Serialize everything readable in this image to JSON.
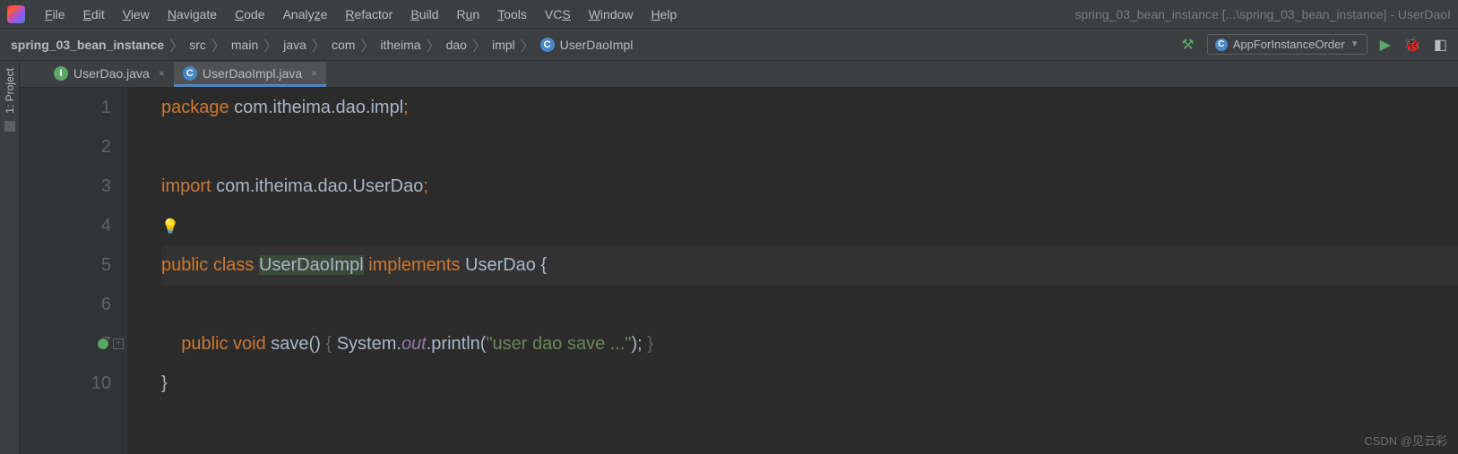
{
  "window": {
    "title": "spring_03_bean_instance [...\\spring_03_bean_instance] - UserDaoI"
  },
  "menu": {
    "file": "File",
    "edit": "Edit",
    "view": "View",
    "navigate": "Navigate",
    "code": "Code",
    "analyze": "Analyze",
    "refactor": "Refactor",
    "build": "Build",
    "run": "Run",
    "tools": "Tools",
    "vcs": "VCS",
    "window": "Window",
    "help": "Help"
  },
  "breadcrumbs": {
    "root": "spring_03_bean_instance",
    "src": "src",
    "main": "main",
    "java": "java",
    "com": "com",
    "itheima": "itheima",
    "dao": "dao",
    "impl": "impl",
    "class": "UserDaoImpl"
  },
  "run_config": {
    "label": "AppForInstanceOrder"
  },
  "side": {
    "project": "1: Project"
  },
  "tabs": {
    "t1": "UserDao.java",
    "t2": "UserDaoImpl.java"
  },
  "code": {
    "l1_kw": "package ",
    "l1_ident": "com.itheima.dao.impl",
    "l1_semi": ";",
    "l3_kw": "import ",
    "l3_ident": "com.itheima.dao.UserDao",
    "l3_semi": ";",
    "l5_kw1": "public class ",
    "l5_cls": "UserDaoImpl",
    "l5_sp": " ",
    "l5_kw2": "implements ",
    "l5_if": "UserDao ",
    "l5_b": "{",
    "l7_pad": "    ",
    "l7_kw": "public void ",
    "l7_m": "save",
    "l7_p": "() ",
    "l7_b1": "{ ",
    "l7_sys": "System.",
    "l7_out": "out",
    "l7_pr": ".println(",
    "l7_str": "\"user dao save ...\"",
    "l7_end": "); ",
    "l7_b2": "}",
    "l10": "}",
    "n1": "1",
    "n2": "2",
    "n3": "3",
    "n4": "4",
    "n5": "5",
    "n6": "6",
    "n7": "7",
    "n10": "10"
  },
  "watermark": "CSDN @见云彩"
}
